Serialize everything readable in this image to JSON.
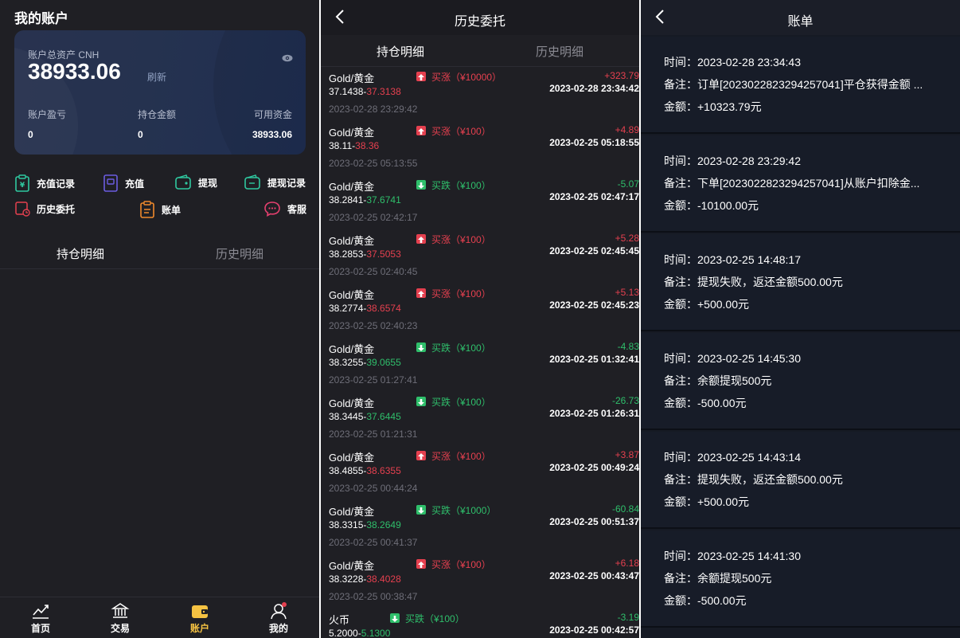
{
  "account": {
    "title": "我的账户",
    "card": {
      "total_label": "账户总资产 CNH",
      "total_value": "38933.06",
      "refresh_label": "刷新",
      "stats": [
        {
          "label": "账户盈亏",
          "value": "0"
        },
        {
          "label": "持仓金额",
          "value": "0"
        },
        {
          "label": "可用资金",
          "value": "38933.06"
        }
      ]
    },
    "actions": [
      {
        "label": "充值记录",
        "icon": "deposit-record-icon"
      },
      {
        "label": "充值",
        "icon": "deposit-icon"
      },
      {
        "label": "提现",
        "icon": "withdraw-icon"
      },
      {
        "label": "提现记录",
        "icon": "withdraw-record-icon"
      },
      {
        "label": "历史委托",
        "icon": "history-order-icon"
      },
      {
        "label": "账单",
        "icon": "bill-icon"
      },
      {
        "label": "客服",
        "icon": "customer-service-icon"
      }
    ],
    "tabs": [
      "持仓明细",
      "历史明细"
    ],
    "nav": [
      "首页",
      "交易",
      "账户",
      "我的"
    ],
    "colors": {
      "active_nav": "#f5c242",
      "up": "#e5404f",
      "down": "#2fbf6b"
    }
  },
  "history": {
    "title": "历史委托",
    "tabs": [
      "持仓明细",
      "历史明细"
    ],
    "records": [
      {
        "name": "Gold/黄金",
        "dir": "up",
        "dir_text": "买涨（¥10000）",
        "open": "37.1438-",
        "close": "37.3138",
        "close_color": "red",
        "time": "2023-02-28 23:29:42",
        "pl": "+323.79",
        "close_time": "2023-02-28 23:34:42"
      },
      {
        "name": "Gold/黄金",
        "dir": "up",
        "dir_text": "买涨（¥100）",
        "open": "38.11-",
        "close": "38.36",
        "close_color": "red",
        "time": "2023-02-25 05:13:55",
        "pl": "+4.89",
        "close_time": "2023-02-25 05:18:55"
      },
      {
        "name": "Gold/黄金",
        "dir": "down",
        "dir_text": "买跌（¥100）",
        "open": "38.2841-",
        "close": "37.6741",
        "close_color": "green",
        "time": "2023-02-25 02:42:17",
        "pl": "-5.07",
        "close_time": "2023-02-25 02:47:17"
      },
      {
        "name": "Gold/黄金",
        "dir": "up",
        "dir_text": "买涨（¥100）",
        "open": "38.2853-",
        "close": "37.5053",
        "close_color": "red",
        "time": "2023-02-25 02:40:45",
        "pl": "+5.28",
        "close_time": "2023-02-25 02:45:45"
      },
      {
        "name": "Gold/黄金",
        "dir": "up",
        "dir_text": "买涨（¥100）",
        "open": "38.2774-",
        "close": "38.6574",
        "close_color": "red",
        "time": "2023-02-25 02:40:23",
        "pl": "+5.13",
        "close_time": "2023-02-25 02:45:23"
      },
      {
        "name": "Gold/黄金",
        "dir": "down",
        "dir_text": "买跌（¥100）",
        "open": "38.3255-",
        "close": "39.0655",
        "close_color": "green",
        "time": "2023-02-25 01:27:41",
        "pl": "-4.83",
        "close_time": "2023-02-25 01:32:41"
      },
      {
        "name": "Gold/黄金",
        "dir": "down",
        "dir_text": "买跌（¥100）",
        "open": "38.3445-",
        "close": "37.6445",
        "close_color": "green",
        "time": "2023-02-25 01:21:31",
        "pl": "-26.73",
        "close_time": "2023-02-25 01:26:31"
      },
      {
        "name": "Gold/黄金",
        "dir": "up",
        "dir_text": "买涨（¥100）",
        "open": "38.4855-",
        "close": "38.6355",
        "close_color": "red",
        "time": "2023-02-25 00:44:24",
        "pl": "+3.87",
        "close_time": "2023-02-25 00:49:24"
      },
      {
        "name": "Gold/黄金",
        "dir": "down",
        "dir_text": "买跌（¥1000）",
        "open": "38.3315-",
        "close": "38.2649",
        "close_color": "green",
        "time": "2023-02-25 00:41:37",
        "pl": "-60.84",
        "close_time": "2023-02-25 00:51:37"
      },
      {
        "name": "Gold/黄金",
        "dir": "up",
        "dir_text": "买涨（¥100）",
        "open": "38.3228-",
        "close": "38.4028",
        "close_color": "red",
        "time": "2023-02-25 00:38:47",
        "pl": "+6.18",
        "close_time": "2023-02-25 00:43:47"
      },
      {
        "name": "火币",
        "dir": "down",
        "dir_text": "买跌（¥100）",
        "open": "5.2000-",
        "close": "5.1300",
        "close_color": "green",
        "time": "",
        "pl": "-3.19",
        "close_time": "2023-02-25 00:42:57"
      }
    ]
  },
  "bill": {
    "title": "账单",
    "entries": [
      {
        "time": "时间：2023-02-28 23:34:43",
        "note": "备注：订单[202302282329425704​1]平仓获得金额 ...",
        "amount": "金额：+10323.79元"
      },
      {
        "time": "时间：2023-02-28 23:29:42",
        "note": "备注：下单[2023022823294257041]从账户扣除金...",
        "amount": "金额：-10100.00元"
      },
      {
        "time": "时间：2023-02-25 14:48:17",
        "note": "备注：提现失败，返还金额500.00元",
        "amount": "金额：+500.00元"
      },
      {
        "time": "时间：2023-02-25 14:45:30",
        "note": "备注：余额提现500元",
        "amount": "金额：-500.00元"
      },
      {
        "time": "时间：2023-02-25 14:43:14",
        "note": "备注：提现失败，返还金额500.00元",
        "amount": "金额：+500.00元"
      },
      {
        "time": "时间：2023-02-25 14:41:30",
        "note": "备注：余额提现500元",
        "amount": "金额：-500.00元"
      }
    ]
  }
}
